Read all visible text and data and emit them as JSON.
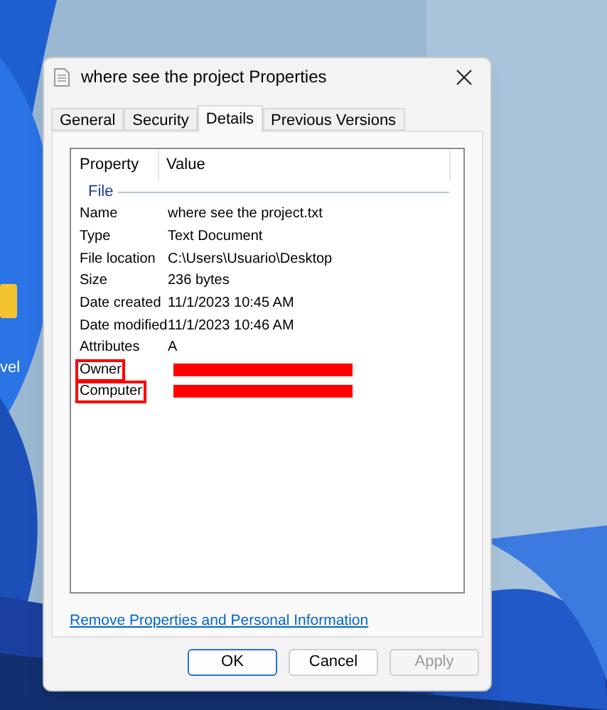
{
  "desktop": {
    "icons": [
      {
        "label": "vel"
      }
    ]
  },
  "window": {
    "title": "where see the project Properties"
  },
  "tabs": [
    {
      "label": "General",
      "selected": false
    },
    {
      "label": "Security",
      "selected": false
    },
    {
      "label": "Details",
      "selected": true
    },
    {
      "label": "Previous Versions",
      "selected": false
    }
  ],
  "table": {
    "columns": [
      "Property",
      "Value"
    ],
    "group": "File",
    "rows": [
      {
        "property": "Name",
        "value": "where see the project.txt",
        "redacted": false,
        "annotated": false
      },
      {
        "property": "Type",
        "value": "Text Document",
        "redacted": false,
        "annotated": false
      },
      {
        "property": "File location",
        "value": "C:\\Users\\Usuario\\Desktop",
        "redacted": false,
        "annotated": false
      },
      {
        "property": "Size",
        "value": "236 bytes",
        "redacted": false,
        "annotated": false
      },
      {
        "property": "Date created",
        "value": "11/1/2023 10:45 AM",
        "redacted": false,
        "annotated": false
      },
      {
        "property": "Date modified",
        "value": "11/1/2023 10:46 AM",
        "redacted": false,
        "annotated": false
      },
      {
        "property": "Attributes",
        "value": "A",
        "redacted": false,
        "annotated": false
      },
      {
        "property": "Owner",
        "redacted": true,
        "annotated": true
      },
      {
        "property": "Computer",
        "redacted": true,
        "annotated": true
      }
    ]
  },
  "link": "Remove Properties and Personal Information",
  "buttons": [
    {
      "label": "OK",
      "default": true,
      "disabled": false
    },
    {
      "label": "Cancel",
      "default": false,
      "disabled": false
    },
    {
      "label": "Apply",
      "default": false,
      "disabled": true
    }
  ]
}
